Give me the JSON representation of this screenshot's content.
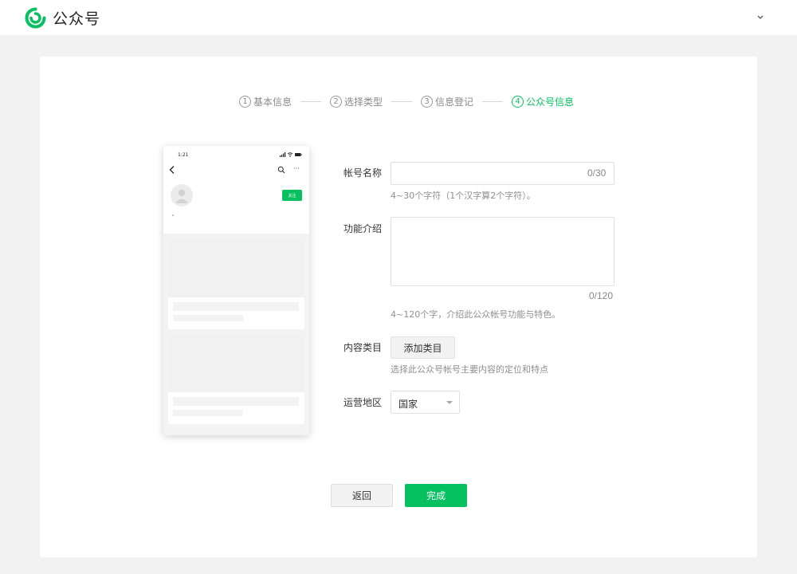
{
  "header": {
    "brand": "公众号",
    "colors": {
      "brand_green": "#07c160"
    },
    "icons": {
      "logo": "wechat-mp-logo-icon",
      "account_menu": "chevron-down-icon"
    }
  },
  "steps": [
    {
      "num": "1",
      "label": "基本信息",
      "active": false
    },
    {
      "num": "2",
      "label": "选择类型",
      "active": false
    },
    {
      "num": "3",
      "label": "信息登记",
      "active": false
    },
    {
      "num": "4",
      "label": "公众号信息",
      "active": true
    }
  ],
  "preview": {
    "time": "1:21",
    "more": "···",
    "follow_label": "关注"
  },
  "form": {
    "name": {
      "label": "帐号名称",
      "value": "",
      "counter": "0/30",
      "hint": "4~30个字符（1个汉字算2个字符）。"
    },
    "intro": {
      "label": "功能介绍",
      "value": "",
      "counter": "0/120",
      "hint": "4~120个字，介绍此公众帐号功能与特色。"
    },
    "category": {
      "label": "内容类目",
      "button": "添加类目",
      "hint": "选择此公众号帐号主要内容的定位和特点"
    },
    "region": {
      "label": "运营地区",
      "value": "国家"
    }
  },
  "actions": {
    "back": "返回",
    "done": "完成"
  }
}
